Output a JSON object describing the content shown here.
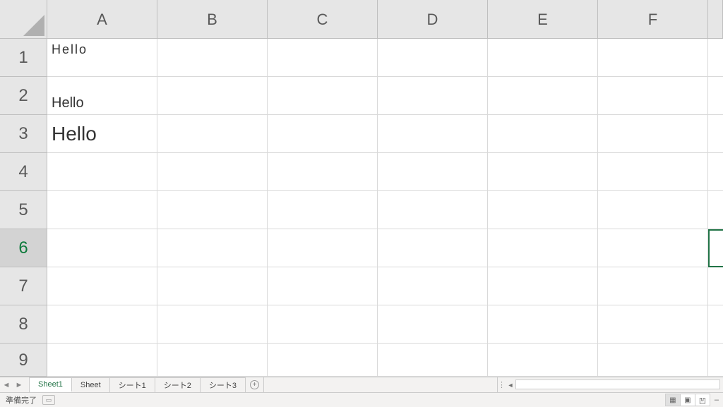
{
  "columns": [
    "A",
    "B",
    "C",
    "D",
    "E",
    "F"
  ],
  "rows": [
    "1",
    "2",
    "3",
    "4",
    "5",
    "6",
    "7",
    "8",
    "9"
  ],
  "active_row_index": 5,
  "cells": {
    "A1": "Hello",
    "A2": "Hello",
    "A3": "Hello"
  },
  "sheet_tabs": {
    "active": "Sheet1",
    "tabs": [
      "Sheet1",
      "Sheet",
      "シート1",
      "シート2",
      "シート3"
    ]
  },
  "status": {
    "ready": "準備完了"
  },
  "icons": {
    "nav_prev": "◄",
    "nav_next": "►",
    "add": "+",
    "dots": "⋮",
    "scroll_left": "◄",
    "view_normal": "▦",
    "view_layout": "▣",
    "view_break": "凹",
    "zoom_dash": "–",
    "macro": "▭"
  }
}
